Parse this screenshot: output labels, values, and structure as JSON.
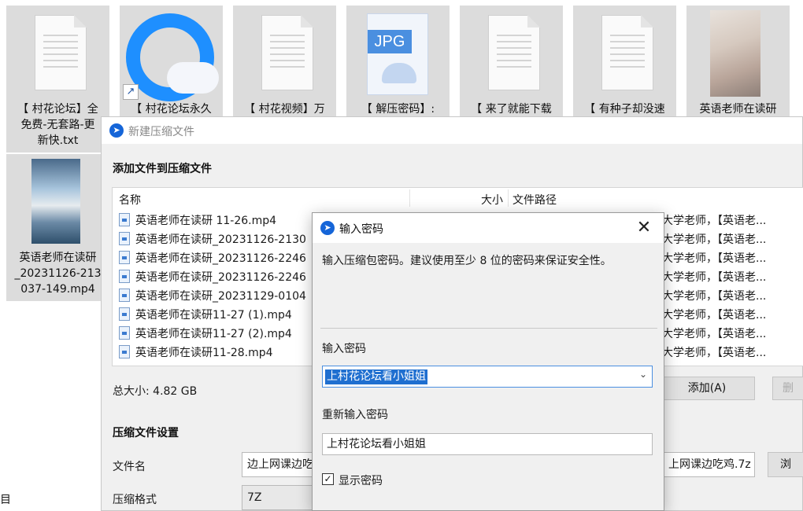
{
  "desktop": {
    "files": [
      {
        "label": "【 村花论坛】全\n免费-无套路-更\n新快.txt",
        "icon": "text-file-icon"
      },
      {
        "label": "【 村花论坛永久",
        "icon": "browser-shortcut-icon"
      },
      {
        "label": "【 村花视频】万",
        "icon": "text-file-icon"
      },
      {
        "label": "【 解压密码】:",
        "icon": "jpg-file-icon",
        "badge": "JPG"
      },
      {
        "label": "【 来了就能下载",
        "icon": "text-file-icon"
      },
      {
        "label": "【 有种子却没速",
        "icon": "text-file-icon"
      },
      {
        "label": "英语老师在读研",
        "icon": "video-thumbnail-icon"
      },
      {
        "label": "英语老师在读研\n_20231126-213\n037-149.mp4",
        "icon": "video-thumbnail-icon"
      }
    ],
    "edge_text": "目"
  },
  "main_window": {
    "title": "新建压缩文件",
    "add_files_title": "添加文件到压缩文件",
    "columns": {
      "name": "名称",
      "size": "大小",
      "path": "文件路径"
    },
    "rows": [
      {
        "name": "英语老师在读研 11-26.mp4",
        "path": "大学老师，【英语老..."
      },
      {
        "name": "英语老师在读研_20231126-2130",
        "path": "大学老师，【英语老..."
      },
      {
        "name": "英语老师在读研_20231126-2246",
        "path": "大学老师，【英语老..."
      },
      {
        "name": "英语老师在读研_20231126-2246",
        "path": "大学老师，【英语老..."
      },
      {
        "name": "英语老师在读研_20231129-0104",
        "path": "大学老师，【英语老..."
      },
      {
        "name": "英语老师在读研11-27 (1).mp4",
        "path": "大学老师，【英语老..."
      },
      {
        "name": "英语老师在读研11-27 (2).mp4",
        "path": "大学老师，【英语老..."
      },
      {
        "name": "英语老师在读研11-28.mp4",
        "path": "大学老师，【英语老..."
      }
    ],
    "total_size": "总大小: 4.82 GB",
    "add_button": "添加(A)",
    "delete_button_partial": "删",
    "settings_title": "压缩文件设置",
    "filename_label": "文件名",
    "filename_value": "边上网课边吃",
    "filename_value_right": "上网课边吃鸡.7z",
    "browse_button_partial": "浏",
    "format_label": "压缩格式",
    "format_value": "7Z"
  },
  "password_dialog": {
    "title": "输入密码",
    "description": "输入压缩包密码。建议使用至少 8 位的密码来保证安全性。",
    "password_label": "输入密码",
    "password_value": "上村花论坛看小姐姐",
    "confirm_label": "重新输入密码",
    "confirm_value": "上村花论坛看小姐姐",
    "show_password_label": "显示密码",
    "show_password_checked": true,
    "close_glyph": "✕",
    "check_glyph": "✓",
    "chevron_glyph": "⌄"
  }
}
